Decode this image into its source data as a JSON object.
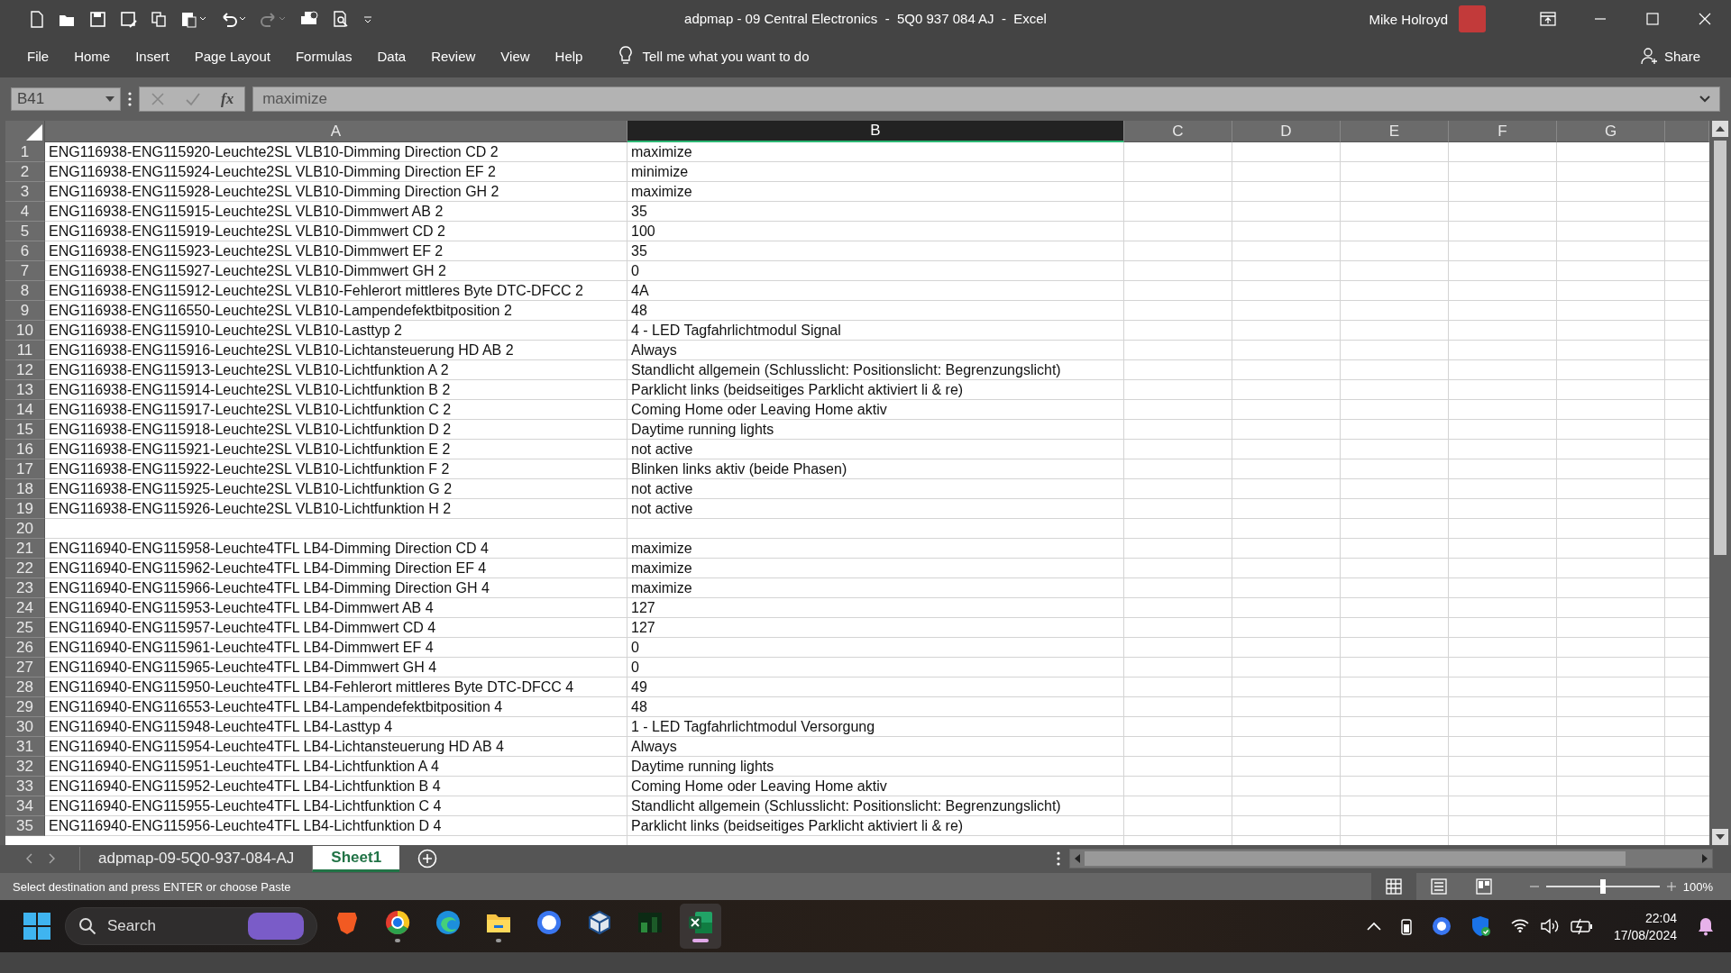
{
  "title_bar": {
    "title": "adpmap - 09 Central Electronics  -  5Q0 937 084 AJ  -  Excel",
    "user": "Mike Holroyd"
  },
  "ribbon_tabs": [
    "File",
    "Home",
    "Insert",
    "Page Layout",
    "Formulas",
    "Data",
    "Review",
    "View",
    "Help"
  ],
  "tell_me": "Tell me what you want to do",
  "share": "Share",
  "formula_bar": {
    "name_box": "B41",
    "function_label": "fx",
    "value": "maximize"
  },
  "columns": [
    {
      "label": "A",
      "selected": false
    },
    {
      "label": "B",
      "selected": true
    },
    {
      "label": "C",
      "selected": false
    },
    {
      "label": "D",
      "selected": false
    },
    {
      "label": "E",
      "selected": false
    },
    {
      "label": "F",
      "selected": false
    },
    {
      "label": "G",
      "selected": false
    }
  ],
  "rows": [
    {
      "number": "1",
      "a": "ENG116938-ENG115920-Leuchte2SL VLB10-Dimming Direction CD 2",
      "b": "maximize"
    },
    {
      "number": "2",
      "a": "ENG116938-ENG115924-Leuchte2SL VLB10-Dimming Direction EF 2",
      "b": "minimize"
    },
    {
      "number": "3",
      "a": "ENG116938-ENG115928-Leuchte2SL VLB10-Dimming Direction GH 2",
      "b": "maximize"
    },
    {
      "number": "4",
      "a": "ENG116938-ENG115915-Leuchte2SL VLB10-Dimmwert AB 2",
      "b": "35"
    },
    {
      "number": "5",
      "a": "ENG116938-ENG115919-Leuchte2SL VLB10-Dimmwert CD 2",
      "b": "100"
    },
    {
      "number": "6",
      "a": "ENG116938-ENG115923-Leuchte2SL VLB10-Dimmwert EF 2",
      "b": "35"
    },
    {
      "number": "7",
      "a": "ENG116938-ENG115927-Leuchte2SL VLB10-Dimmwert GH 2",
      "b": "0"
    },
    {
      "number": "8",
      "a": "ENG116938-ENG115912-Leuchte2SL VLB10-Fehlerort mittleres Byte DTC-DFCC 2",
      "b": "4A"
    },
    {
      "number": "9",
      "a": "ENG116938-ENG116550-Leuchte2SL VLB10-Lampendefektbitposition 2",
      "b": "48"
    },
    {
      "number": "10",
      "a": "ENG116938-ENG115910-Leuchte2SL VLB10-Lasttyp 2",
      "b": "4 - LED Tagfahrlichtmodul Signal"
    },
    {
      "number": "11",
      "a": "ENG116938-ENG115916-Leuchte2SL VLB10-Lichtansteuerung HD AB 2",
      "b": "Always"
    },
    {
      "number": "12",
      "a": "ENG116938-ENG115913-Leuchte2SL VLB10-Lichtfunktion A 2",
      "b": "Standlicht allgemein (Schlusslicht: Positionslicht: Begrenzungslicht)"
    },
    {
      "number": "13",
      "a": "ENG116938-ENG115914-Leuchte2SL VLB10-Lichtfunktion B 2",
      "b": "Parklicht links (beidseitiges Parklicht aktiviert li & re)"
    },
    {
      "number": "14",
      "a": "ENG116938-ENG115917-Leuchte2SL VLB10-Lichtfunktion C 2",
      "b": "Coming Home oder Leaving Home aktiv"
    },
    {
      "number": "15",
      "a": "ENG116938-ENG115918-Leuchte2SL VLB10-Lichtfunktion D 2",
      "b": "Daytime running lights"
    },
    {
      "number": "16",
      "a": "ENG116938-ENG115921-Leuchte2SL VLB10-Lichtfunktion E 2",
      "b": "not active"
    },
    {
      "number": "17",
      "a": "ENG116938-ENG115922-Leuchte2SL VLB10-Lichtfunktion F 2",
      "b": "Blinken links aktiv (beide Phasen)"
    },
    {
      "number": "18",
      "a": "ENG116938-ENG115925-Leuchte2SL VLB10-Lichtfunktion G 2",
      "b": "not active"
    },
    {
      "number": "19",
      "a": "ENG116938-ENG115926-Leuchte2SL VLB10-Lichtfunktion H 2",
      "b": "not active"
    },
    {
      "number": "20"
    },
    {
      "number": "21",
      "a": "ENG116940-ENG115958-Leuchte4TFL LB4-Dimming Direction CD 4",
      "b": "maximize"
    },
    {
      "number": "22",
      "a": "ENG116940-ENG115962-Leuchte4TFL LB4-Dimming Direction EF 4",
      "b": "maximize"
    },
    {
      "number": "23",
      "a": "ENG116940-ENG115966-Leuchte4TFL LB4-Dimming Direction GH 4",
      "b": "maximize"
    },
    {
      "number": "24",
      "a": "ENG116940-ENG115953-Leuchte4TFL LB4-Dimmwert AB 4",
      "b": "127"
    },
    {
      "number": "25",
      "a": "ENG116940-ENG115957-Leuchte4TFL LB4-Dimmwert CD 4",
      "b": "127"
    },
    {
      "number": "26",
      "a": "ENG116940-ENG115961-Leuchte4TFL LB4-Dimmwert EF 4",
      "b": "0"
    },
    {
      "number": "27",
      "a": "ENG116940-ENG115965-Leuchte4TFL LB4-Dimmwert GH 4",
      "b": "0"
    },
    {
      "number": "28",
      "a": "ENG116940-ENG115950-Leuchte4TFL LB4-Fehlerort mittleres Byte DTC-DFCC 4",
      "b": "49"
    },
    {
      "number": "29",
      "a": "ENG116940-ENG116553-Leuchte4TFL LB4-Lampendefektbitposition 4",
      "b": "48"
    },
    {
      "number": "30",
      "a": "ENG116940-ENG115948-Leuchte4TFL LB4-Lasttyp 4",
      "b": "1 - LED Tagfahrlichtmodul Versorgung"
    },
    {
      "number": "31",
      "a": "ENG116940-ENG115954-Leuchte4TFL LB4-Lichtansteuerung HD AB 4",
      "b": "Always"
    },
    {
      "number": "32",
      "a": "ENG116940-ENG115951-Leuchte4TFL LB4-Lichtfunktion A 4",
      "b": "Daytime running lights"
    },
    {
      "number": "33",
      "a": "ENG116940-ENG115952-Leuchte4TFL LB4-Lichtfunktion B 4",
      "b": "Coming Home oder Leaving Home aktiv"
    },
    {
      "number": "34",
      "a": "ENG116940-ENG115955-Leuchte4TFL LB4-Lichtfunktion C 4",
      "b": "Standlicht allgemein (Schlusslicht: Positionslicht: Begrenzungslicht)"
    },
    {
      "number": "35",
      "a": "ENG116940-ENG115956-Leuchte4TFL LB4-Lichtfunktion D 4",
      "b": "Parklicht links (beidseitiges Parklicht aktiviert li & re)"
    }
  ],
  "sheet_tabs": [
    {
      "label": "adpmap-09-5Q0-937-084-AJ",
      "selected": false
    },
    {
      "label": "Sheet1",
      "selected": true
    }
  ],
  "status": "Select destination and press ENTER or choose Paste",
  "view_buttons": [
    {
      "selected": true
    },
    {
      "selected": false
    },
    {
      "selected": false
    }
  ],
  "zoom": {
    "level": 0.5,
    "reading": "100%"
  },
  "taskbar": {
    "search_placeholder": "Search",
    "apps": [
      {
        "running": false,
        "active": false
      },
      {
        "running": true,
        "active": false
      },
      {
        "running": false,
        "active": false
      },
      {
        "running": true,
        "active": false
      },
      {
        "running": false,
        "active": false
      },
      {
        "running": false,
        "active": false
      },
      {
        "running": false,
        "active": false
      },
      {
        "running": true,
        "active": true
      }
    ],
    "time": "22:04",
    "date": "17/08/2024"
  }
}
